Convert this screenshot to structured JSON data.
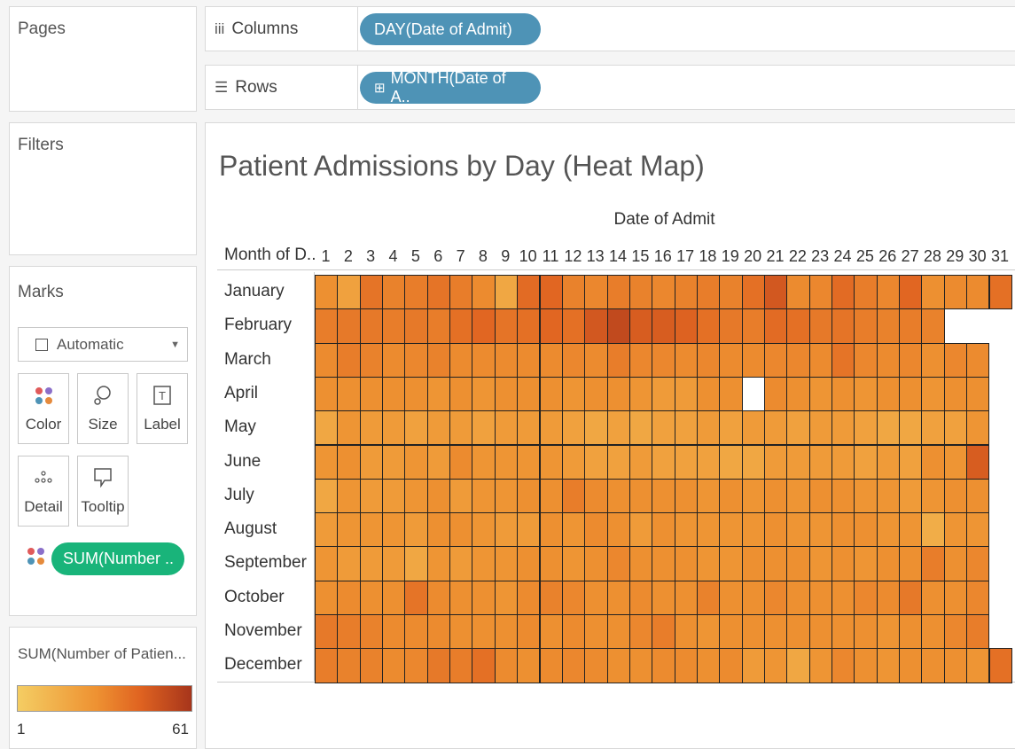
{
  "pages_title": "Pages",
  "filters_title": "Filters",
  "marks": {
    "title": "Marks",
    "mark_type": "Automatic",
    "buttons": {
      "color": "Color",
      "size": "Size",
      "label": "Label",
      "detail": "Detail",
      "tooltip": "Tooltip"
    },
    "field_pill": "SUM(Number .."
  },
  "legend": {
    "title": "SUM(Number of Patien...",
    "min": "1",
    "max": "61",
    "colors": [
      "#f4cd63",
      "#ee9232",
      "#e06421",
      "#a7351b"
    ]
  },
  "shelves": {
    "columns_label": "Columns",
    "columns_pill": "DAY(Date of Admit)",
    "rows_label": "Rows",
    "rows_pill": "MONTH(Date of A.."
  },
  "colors": {
    "pill_blue": "#4e93b6",
    "pill_green": "#19b47a"
  },
  "chart_data": {
    "type": "heatmap",
    "title": "Patient Admissions by Day (Heat Map)",
    "xlabel": "Date of Admit",
    "ylabel": "Month of D..",
    "value_label": "SUM(Number of Patients)",
    "value_range": [
      1,
      61
    ],
    "x": [
      "1",
      "2",
      "3",
      "4",
      "5",
      "6",
      "7",
      "8",
      "9",
      "10",
      "11",
      "12",
      "13",
      "14",
      "15",
      "16",
      "17",
      "18",
      "19",
      "20",
      "21",
      "22",
      "23",
      "24",
      "25",
      "26",
      "27",
      "28",
      "29",
      "30",
      "31"
    ],
    "y": [
      "January",
      "February",
      "March",
      "April",
      "May",
      "June",
      "July",
      "August",
      "September",
      "October",
      "November",
      "December"
    ],
    "values": [
      [
        22,
        16,
        34,
        28,
        30,
        34,
        30,
        24,
        14,
        38,
        40,
        28,
        26,
        30,
        28,
        26,
        28,
        30,
        28,
        36,
        46,
        24,
        26,
        38,
        30,
        26,
        40,
        22,
        24,
        24,
        36
      ],
      [
        30,
        32,
        32,
        30,
        32,
        30,
        36,
        40,
        34,
        36,
        40,
        36,
        46,
        52,
        44,
        44,
        42,
        36,
        32,
        30,
        38,
        36,
        32,
        34,
        30,
        28,
        30,
        28,
        null,
        null,
        null
      ],
      [
        24,
        30,
        28,
        24,
        26,
        28,
        24,
        24,
        24,
        24,
        24,
        26,
        24,
        30,
        26,
        26,
        24,
        26,
        24,
        24,
        26,
        26,
        24,
        34,
        26,
        24,
        26,
        22,
        26,
        24,
        null
      ],
      [
        22,
        22,
        22,
        22,
        22,
        20,
        22,
        20,
        22,
        22,
        22,
        20,
        22,
        22,
        20,
        18,
        18,
        22,
        22,
        null,
        24,
        22,
        20,
        22,
        20,
        22,
        22,
        20,
        22,
        22,
        null
      ],
      [
        14,
        20,
        18,
        18,
        16,
        18,
        18,
        16,
        18,
        18,
        18,
        16,
        14,
        16,
        14,
        16,
        16,
        18,
        16,
        18,
        18,
        16,
        18,
        18,
        16,
        14,
        14,
        16,
        16,
        20,
        null
      ],
      [
        20,
        22,
        18,
        18,
        20,
        18,
        24,
        20,
        20,
        20,
        20,
        18,
        16,
        16,
        18,
        16,
        16,
        16,
        14,
        14,
        18,
        18,
        18,
        18,
        16,
        18,
        16,
        22,
        20,
        44,
        null
      ],
      [
        14,
        20,
        18,
        18,
        20,
        22,
        18,
        20,
        20,
        22,
        22,
        30,
        24,
        22,
        22,
        22,
        22,
        20,
        22,
        20,
        22,
        20,
        22,
        22,
        20,
        20,
        18,
        20,
        22,
        22,
        null
      ],
      [
        18,
        20,
        20,
        20,
        18,
        22,
        22,
        20,
        18,
        18,
        22,
        20,
        24,
        22,
        18,
        22,
        20,
        20,
        20,
        20,
        22,
        20,
        20,
        22,
        22,
        20,
        20,
        12,
        20,
        20,
        null
      ],
      [
        20,
        18,
        18,
        18,
        14,
        20,
        18,
        20,
        20,
        22,
        22,
        20,
        22,
        26,
        22,
        22,
        22,
        20,
        20,
        22,
        22,
        22,
        20,
        22,
        20,
        22,
        22,
        30,
        22,
        26,
        null
      ],
      [
        22,
        24,
        22,
        22,
        34,
        24,
        22,
        22,
        20,
        24,
        28,
        26,
        22,
        22,
        24,
        22,
        22,
        28,
        22,
        22,
        26,
        22,
        22,
        22,
        26,
        24,
        32,
        22,
        22,
        26,
        null
      ],
      [
        32,
        30,
        28,
        24,
        24,
        24,
        22,
        22,
        22,
        24,
        22,
        24,
        22,
        22,
        26,
        30,
        22,
        20,
        22,
        22,
        22,
        22,
        22,
        22,
        22,
        20,
        22,
        22,
        26,
        30,
        null
      ],
      [
        30,
        28,
        28,
        24,
        26,
        32,
        30,
        36,
        24,
        22,
        24,
        26,
        24,
        22,
        22,
        24,
        24,
        22,
        24,
        18,
        20,
        14,
        20,
        26,
        22,
        20,
        22,
        22,
        22,
        20,
        36
      ]
    ]
  }
}
